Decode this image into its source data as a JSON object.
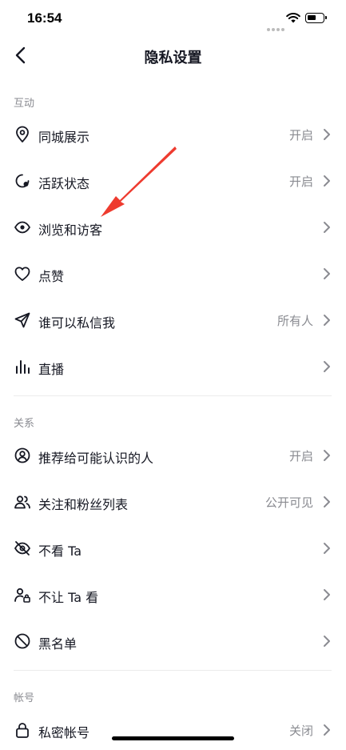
{
  "status_bar": {
    "time": "16:54"
  },
  "header": {
    "title": "隐私设置"
  },
  "sections": {
    "interaction": {
      "title": "互动",
      "items": [
        {
          "label": "同城展示",
          "value": "开启",
          "icon": "location-pin-icon"
        },
        {
          "label": "活跃状态",
          "value": "开启",
          "icon": "activity-status-icon"
        },
        {
          "label": "浏览和访客",
          "value": "",
          "icon": "eye-icon"
        },
        {
          "label": "点赞",
          "value": "",
          "icon": "heart-icon"
        },
        {
          "label": "谁可以私信我",
          "value": "所有人",
          "icon": "send-icon"
        },
        {
          "label": "直播",
          "value": "",
          "icon": "live-bars-icon"
        }
      ]
    },
    "relations": {
      "title": "关系",
      "items": [
        {
          "label": "推荐给可能认识的人",
          "value": "开启",
          "icon": "user-circle-icon"
        },
        {
          "label": "关注和粉丝列表",
          "value": "公开可见",
          "icon": "users-icon"
        },
        {
          "label": "不看 Ta",
          "value": "",
          "icon": "eye-off-icon"
        },
        {
          "label": "不让 Ta 看",
          "value": "",
          "icon": "user-lock-icon"
        },
        {
          "label": "黑名单",
          "value": "",
          "icon": "block-icon"
        }
      ]
    },
    "account": {
      "title": "帐号",
      "items": [
        {
          "label": "私密帐号",
          "value": "关闭",
          "icon": "lock-icon"
        }
      ]
    }
  },
  "colors": {
    "annotation_arrow": "#ee3b2f",
    "secondary_text": "#8a8b91"
  }
}
